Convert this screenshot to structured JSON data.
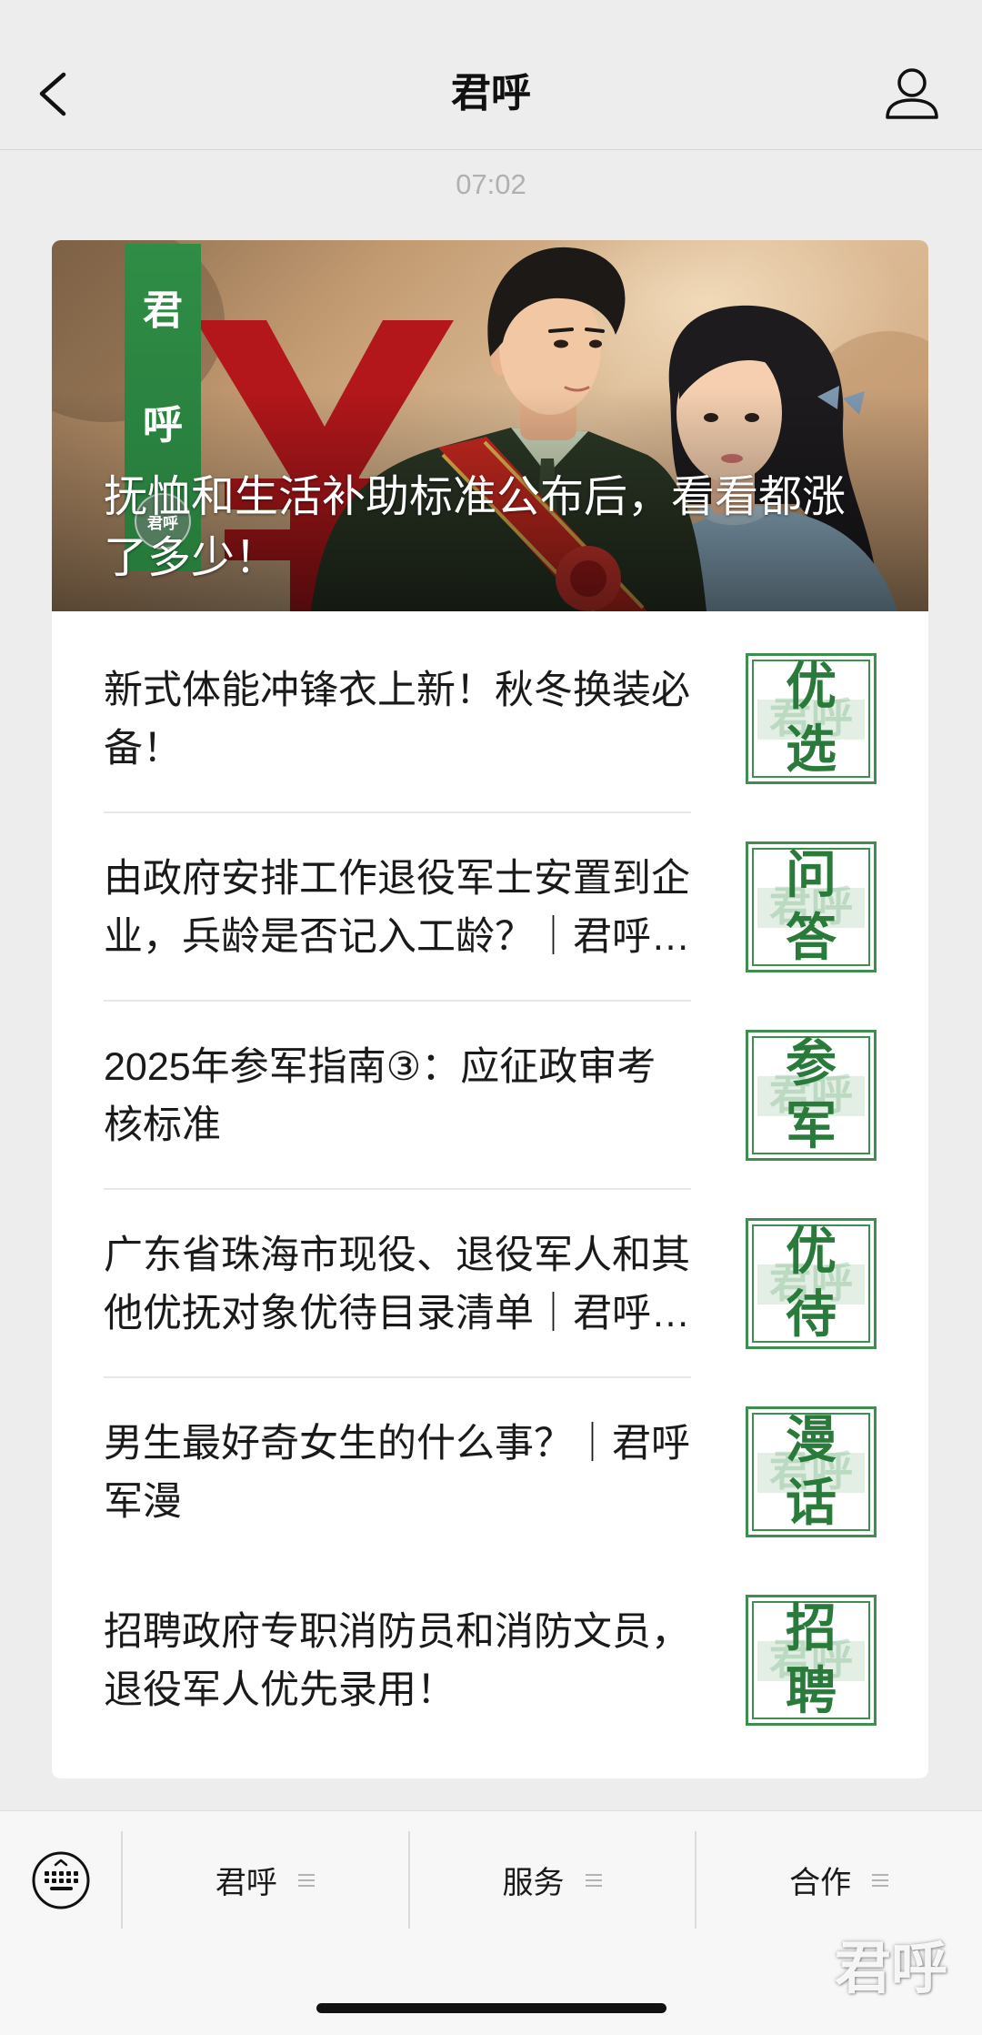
{
  "nav": {
    "title": "君呼",
    "back_icon": "chevron-left-icon",
    "profile_icon": "person-icon"
  },
  "timestamp": "07:02",
  "article": {
    "hero": {
      "title_lines": [
        "抚恤和生活补助标准公布后，看看都涨",
        "了多少！"
      ],
      "brand_tag": [
        "君",
        "呼"
      ],
      "logo_text": "君呼"
    },
    "thumb_watermark": "君呼",
    "items": [
      {
        "lines": [
          "新式体能冲锋衣上新！秋冬换装必",
          "备！"
        ],
        "thumb": [
          "优",
          "选"
        ]
      },
      {
        "lines": [
          "由政府安排工作退役军士安置到企",
          "业，兵龄是否记入工龄？｜君呼…"
        ],
        "thumb": [
          "问",
          "答"
        ]
      },
      {
        "lines": [
          "2025年参军指南③：应征政审考",
          "核标准"
        ],
        "thumb": [
          "参",
          "军"
        ]
      },
      {
        "lines": [
          "广东省珠海市现役、退役军人和其",
          "他优抚对象优待目录清单｜君呼…"
        ],
        "thumb": [
          "优",
          "待"
        ]
      },
      {
        "lines": [
          "男生最好奇女生的什么事？｜君呼",
          "军漫"
        ],
        "thumb": [
          "漫",
          "话"
        ]
      },
      {
        "lines": [
          "招聘政府专职消防员和消防文员，",
          "退役军人优先录用！"
        ],
        "thumb": [
          "招",
          "聘"
        ]
      }
    ]
  },
  "menu": {
    "keyboard_icon": "keyboard-icon",
    "items": [
      {
        "label": "君呼",
        "icon": "menu-lines-icon"
      },
      {
        "label": "服务",
        "icon": "menu-lines-icon"
      },
      {
        "label": "合作",
        "icon": "menu-lines-icon"
      }
    ]
  },
  "watermark": "君呼",
  "colors": {
    "page_bg": "#ededed",
    "card_bg": "#ffffff",
    "brand_green": "#2f8a44",
    "thumb_green": "#2a7b3b",
    "text": "#1a1a1a",
    "muted": "#b0b0b0"
  }
}
